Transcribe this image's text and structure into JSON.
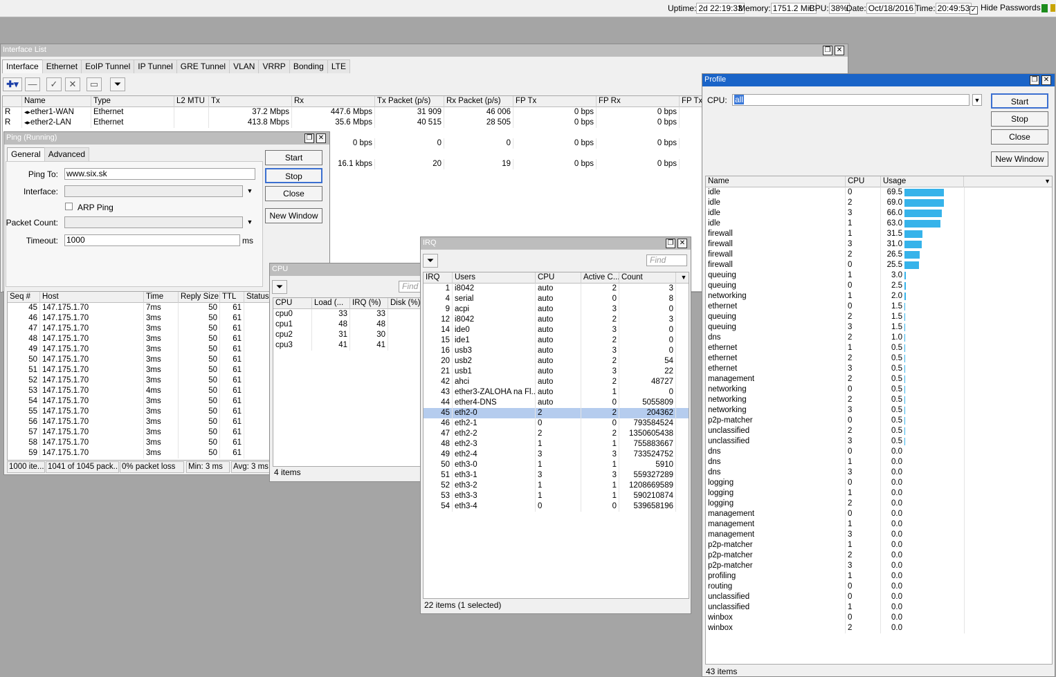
{
  "status": {
    "uptime_label": "Uptime:",
    "uptime": "2d 22:19:33",
    "memory_label": "Memory:",
    "memory": "1751.2 MiB",
    "cpu_label": "CPU:",
    "cpu": "38%",
    "date_label": "Date:",
    "date": "Oct/18/2016",
    "time_label": "Time:",
    "time": "20:49:53",
    "hide_passwords": "Hide Passwords"
  },
  "interface_list": {
    "title": "Interface List",
    "tabs": [
      "Interface",
      "Ethernet",
      "EoIP Tunnel",
      "IP Tunnel",
      "GRE Tunnel",
      "VLAN",
      "VRRP",
      "Bonding",
      "LTE"
    ],
    "columns": [
      "Name",
      "Type",
      "L2 MTU",
      "Tx",
      "Rx",
      "Tx Packet (p/s)",
      "Rx Packet (p/s)",
      "FP Tx",
      "FP Rx",
      "FP Tx"
    ],
    "rows": [
      {
        "flag": "R",
        "name": "ether1-WAN",
        "type": "Ethernet",
        "l2mtu": "",
        "tx": "37.2 Mbps",
        "rx": "447.6 Mbps",
        "txp": "31 909",
        "rxp": "46 006",
        "fptx": "0 bps",
        "fprx": "0 bps"
      },
      {
        "flag": "R",
        "name": "ether2-LAN",
        "type": "Ethernet",
        "l2mtu": "",
        "tx": "413.8 Mbps",
        "rx": "35.6 Mbps",
        "txp": "40 515",
        "rxp": "28 505",
        "fptx": "0 bps",
        "fprx": "0 bps"
      },
      {
        "flag": "",
        "name": "",
        "type": "",
        "l2mtu": "",
        "tx": "",
        "rx": "0 bps",
        "txp": "0",
        "rxp": "0",
        "fptx": "0 bps",
        "fprx": "0 bps"
      },
      {
        "flag": "",
        "name": "",
        "type": "",
        "l2mtu": "",
        "tx": "",
        "rx": "16.1 kbps",
        "txp": "20",
        "rxp": "19",
        "fptx": "0 bps",
        "fprx": "0 bps"
      }
    ]
  },
  "ping": {
    "title": "Ping (Running)",
    "tabs": [
      "General",
      "Advanced"
    ],
    "ping_to_label": "Ping To:",
    "ping_to": "www.six.sk",
    "interface_label": "Interface:",
    "arp_ping": "ARP Ping",
    "packet_count_label": "Packet Count:",
    "timeout_label": "Timeout:",
    "timeout": "1000",
    "timeout_unit": "ms",
    "buttons": {
      "start": "Start",
      "stop": "Stop",
      "close": "Close",
      "new_window": "New Window"
    },
    "columns": [
      "Seq #",
      "Host",
      "Time",
      "Reply Size",
      "TTL",
      "Status"
    ],
    "rows": [
      {
        "seq": "45",
        "host": "147.175.1.70",
        "time": "7ms",
        "size": "50",
        "ttl": "61"
      },
      {
        "seq": "46",
        "host": "147.175.1.70",
        "time": "3ms",
        "size": "50",
        "ttl": "61"
      },
      {
        "seq": "47",
        "host": "147.175.1.70",
        "time": "3ms",
        "size": "50",
        "ttl": "61"
      },
      {
        "seq": "48",
        "host": "147.175.1.70",
        "time": "3ms",
        "size": "50",
        "ttl": "61"
      },
      {
        "seq": "49",
        "host": "147.175.1.70",
        "time": "3ms",
        "size": "50",
        "ttl": "61"
      },
      {
        "seq": "50",
        "host": "147.175.1.70",
        "time": "3ms",
        "size": "50",
        "ttl": "61"
      },
      {
        "seq": "51",
        "host": "147.175.1.70",
        "time": "3ms",
        "size": "50",
        "ttl": "61"
      },
      {
        "seq": "52",
        "host": "147.175.1.70",
        "time": "3ms",
        "size": "50",
        "ttl": "61"
      },
      {
        "seq": "53",
        "host": "147.175.1.70",
        "time": "4ms",
        "size": "50",
        "ttl": "61"
      },
      {
        "seq": "54",
        "host": "147.175.1.70",
        "time": "3ms",
        "size": "50",
        "ttl": "61"
      },
      {
        "seq": "55",
        "host": "147.175.1.70",
        "time": "3ms",
        "size": "50",
        "ttl": "61"
      },
      {
        "seq": "56",
        "host": "147.175.1.70",
        "time": "3ms",
        "size": "50",
        "ttl": "61"
      },
      {
        "seq": "57",
        "host": "147.175.1.70",
        "time": "3ms",
        "size": "50",
        "ttl": "61"
      },
      {
        "seq": "58",
        "host": "147.175.1.70",
        "time": "3ms",
        "size": "50",
        "ttl": "61"
      },
      {
        "seq": "59",
        "host": "147.175.1.70",
        "time": "3ms",
        "size": "50",
        "ttl": "61"
      }
    ],
    "status": [
      "1000 ite...",
      "1041 of 1045 pack...",
      "0% packet loss",
      "Min: 3 ms",
      "Avg: 3 ms"
    ]
  },
  "cpu": {
    "title": "CPU",
    "find": "Find",
    "columns": [
      "CPU",
      "Load (...",
      "IRQ (%)",
      "Disk (%)"
    ],
    "rows": [
      {
        "cpu": "cpu0",
        "load": "33",
        "irq": "33"
      },
      {
        "cpu": "cpu1",
        "load": "48",
        "irq": "48"
      },
      {
        "cpu": "cpu2",
        "load": "31",
        "irq": "30"
      },
      {
        "cpu": "cpu3",
        "load": "41",
        "irq": "41"
      }
    ],
    "status": "4 items"
  },
  "irq": {
    "title": "IRQ",
    "find": "Find",
    "columns": [
      "IRQ",
      "Users",
      "CPU",
      "Active C...",
      "Count"
    ],
    "rows": [
      {
        "irq": "1",
        "users": "i8042",
        "cpu": "auto",
        "active": "2",
        "count": "3"
      },
      {
        "irq": "4",
        "users": "serial",
        "cpu": "auto",
        "active": "0",
        "count": "8"
      },
      {
        "irq": "9",
        "users": "acpi",
        "cpu": "auto",
        "active": "3",
        "count": "0"
      },
      {
        "irq": "12",
        "users": "i8042",
        "cpu": "auto",
        "active": "2",
        "count": "3"
      },
      {
        "irq": "14",
        "users": "ide0",
        "cpu": "auto",
        "active": "3",
        "count": "0"
      },
      {
        "irq": "15",
        "users": "ide1",
        "cpu": "auto",
        "active": "2",
        "count": "0"
      },
      {
        "irq": "16",
        "users": "usb3",
        "cpu": "auto",
        "active": "3",
        "count": "0"
      },
      {
        "irq": "20",
        "users": "usb2",
        "cpu": "auto",
        "active": "2",
        "count": "54"
      },
      {
        "irq": "21",
        "users": "usb1",
        "cpu": "auto",
        "active": "3",
        "count": "22"
      },
      {
        "irq": "42",
        "users": "ahci",
        "cpu": "auto",
        "active": "2",
        "count": "48727"
      },
      {
        "irq": "43",
        "users": "ether3-ZALOHA na Fl...",
        "cpu": "auto",
        "active": "1",
        "count": "0"
      },
      {
        "irq": "44",
        "users": "ether4-DNS",
        "cpu": "auto",
        "active": "0",
        "count": "5055809"
      },
      {
        "irq": "45",
        "users": "eth2-0",
        "cpu": "2",
        "active": "2",
        "count": "204362",
        "selected": true
      },
      {
        "irq": "46",
        "users": "eth2-1",
        "cpu": "0",
        "active": "0",
        "count": "793584524"
      },
      {
        "irq": "47",
        "users": "eth2-2",
        "cpu": "2",
        "active": "2",
        "count": "1350605438"
      },
      {
        "irq": "48",
        "users": "eth2-3",
        "cpu": "1",
        "active": "1",
        "count": "755883667"
      },
      {
        "irq": "49",
        "users": "eth2-4",
        "cpu": "3",
        "active": "3",
        "count": "733524752"
      },
      {
        "irq": "50",
        "users": "eth3-0",
        "cpu": "1",
        "active": "1",
        "count": "5910"
      },
      {
        "irq": "51",
        "users": "eth3-1",
        "cpu": "3",
        "active": "3",
        "count": "559327289"
      },
      {
        "irq": "52",
        "users": "eth3-2",
        "cpu": "1",
        "active": "1",
        "count": "1208669589"
      },
      {
        "irq": "53",
        "users": "eth3-3",
        "cpu": "1",
        "active": "1",
        "count": "590210874"
      },
      {
        "irq": "54",
        "users": "eth3-4",
        "cpu": "0",
        "active": "0",
        "count": "539658196"
      }
    ],
    "status": "22 items (1 selected)"
  },
  "profile": {
    "title": "Profile",
    "cpu_label": "CPU:",
    "cpu_value": "all",
    "buttons": {
      "start": "Start",
      "stop": "Stop",
      "close": "Close",
      "new_window": "New Window"
    },
    "columns": [
      "Name",
      "CPU",
      "Usage"
    ],
    "rows": [
      {
        "name": "idle",
        "cpu": "0",
        "usage": "69.5"
      },
      {
        "name": "idle",
        "cpu": "2",
        "usage": "69.0"
      },
      {
        "name": "idle",
        "cpu": "3",
        "usage": "66.0"
      },
      {
        "name": "idle",
        "cpu": "1",
        "usage": "63.0"
      },
      {
        "name": "firewall",
        "cpu": "1",
        "usage": "31.5"
      },
      {
        "name": "firewall",
        "cpu": "3",
        "usage": "31.0"
      },
      {
        "name": "firewall",
        "cpu": "2",
        "usage": "26.5"
      },
      {
        "name": "firewall",
        "cpu": "0",
        "usage": "25.5"
      },
      {
        "name": "queuing",
        "cpu": "1",
        "usage": "3.0"
      },
      {
        "name": "queuing",
        "cpu": "0",
        "usage": "2.5"
      },
      {
        "name": "networking",
        "cpu": "1",
        "usage": "2.0"
      },
      {
        "name": "ethernet",
        "cpu": "0",
        "usage": "1.5"
      },
      {
        "name": "queuing",
        "cpu": "2",
        "usage": "1.5"
      },
      {
        "name": "queuing",
        "cpu": "3",
        "usage": "1.5"
      },
      {
        "name": "dns",
        "cpu": "2",
        "usage": "1.0"
      },
      {
        "name": "ethernet",
        "cpu": "1",
        "usage": "0.5"
      },
      {
        "name": "ethernet",
        "cpu": "2",
        "usage": "0.5"
      },
      {
        "name": "ethernet",
        "cpu": "3",
        "usage": "0.5"
      },
      {
        "name": "management",
        "cpu": "2",
        "usage": "0.5"
      },
      {
        "name": "networking",
        "cpu": "0",
        "usage": "0.5"
      },
      {
        "name": "networking",
        "cpu": "2",
        "usage": "0.5"
      },
      {
        "name": "networking",
        "cpu": "3",
        "usage": "0.5"
      },
      {
        "name": "p2p-matcher",
        "cpu": "0",
        "usage": "0.5"
      },
      {
        "name": "unclassified",
        "cpu": "2",
        "usage": "0.5"
      },
      {
        "name": "unclassified",
        "cpu": "3",
        "usage": "0.5"
      },
      {
        "name": "dns",
        "cpu": "0",
        "usage": "0.0"
      },
      {
        "name": "dns",
        "cpu": "1",
        "usage": "0.0"
      },
      {
        "name": "dns",
        "cpu": "3",
        "usage": "0.0"
      },
      {
        "name": "logging",
        "cpu": "0",
        "usage": "0.0"
      },
      {
        "name": "logging",
        "cpu": "1",
        "usage": "0.0"
      },
      {
        "name": "logging",
        "cpu": "2",
        "usage": "0.0"
      },
      {
        "name": "management",
        "cpu": "0",
        "usage": "0.0"
      },
      {
        "name": "management",
        "cpu": "1",
        "usage": "0.0"
      },
      {
        "name": "management",
        "cpu": "3",
        "usage": "0.0"
      },
      {
        "name": "p2p-matcher",
        "cpu": "1",
        "usage": "0.0"
      },
      {
        "name": "p2p-matcher",
        "cpu": "2",
        "usage": "0.0"
      },
      {
        "name": "p2p-matcher",
        "cpu": "3",
        "usage": "0.0"
      },
      {
        "name": "profiling",
        "cpu": "1",
        "usage": "0.0"
      },
      {
        "name": "routing",
        "cpu": "0",
        "usage": "0.0"
      },
      {
        "name": "unclassified",
        "cpu": "0",
        "usage": "0.0"
      },
      {
        "name": "unclassified",
        "cpu": "1",
        "usage": "0.0"
      },
      {
        "name": "winbox",
        "cpu": "0",
        "usage": "0.0"
      },
      {
        "name": "winbox",
        "cpu": "2",
        "usage": "0.0"
      }
    ],
    "status": "43 items"
  },
  "colors": {
    "title_active": "#1a64c8",
    "title_inactive": "#bdbdbd",
    "usage_bar": "#36b3ea",
    "selected_row": "#b5ccee",
    "desktop": "#a5a5a5"
  },
  "icons": [
    "plus-icon",
    "minus-icon",
    "check-icon",
    "cross-icon",
    "comment-icon",
    "filter-icon",
    "close-icon",
    "restore-icon",
    "dropdown-arrow-icon",
    "ethernet-icon"
  ]
}
